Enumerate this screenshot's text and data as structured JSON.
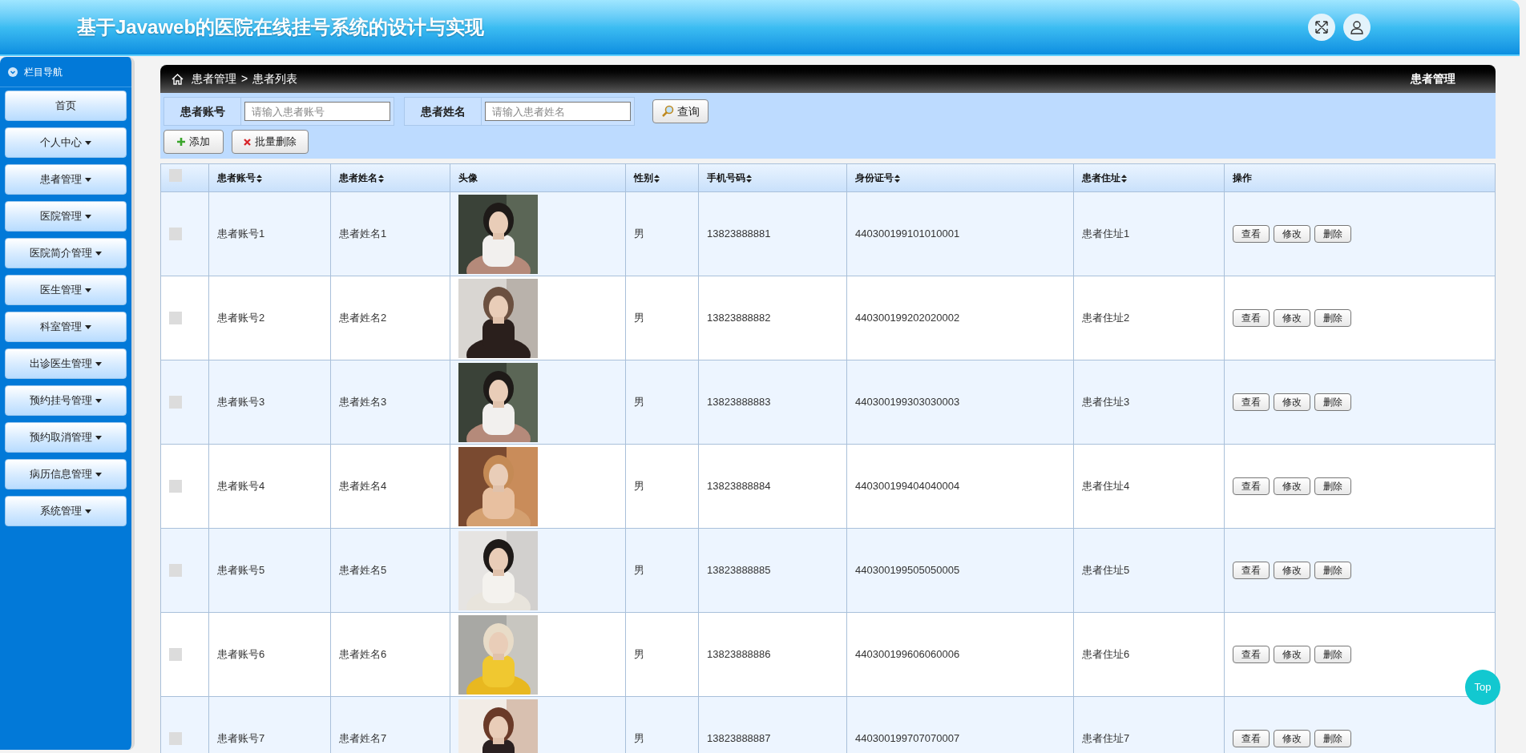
{
  "header": {
    "title": "基于Javaweb的医院在线挂号系统的设计与实现"
  },
  "sidebar": {
    "title": "栏目导航",
    "items": [
      {
        "label": "首页",
        "dropdown": false
      },
      {
        "label": "个人中心",
        "dropdown": true
      },
      {
        "label": "患者管理",
        "dropdown": true
      },
      {
        "label": "医院管理",
        "dropdown": true
      },
      {
        "label": "医院简介管理",
        "dropdown": true
      },
      {
        "label": "医生管理",
        "dropdown": true
      },
      {
        "label": "科室管理",
        "dropdown": true
      },
      {
        "label": "出诊医生管理",
        "dropdown": true
      },
      {
        "label": "预约挂号管理",
        "dropdown": true
      },
      {
        "label": "预约取消管理",
        "dropdown": true
      },
      {
        "label": "病历信息管理",
        "dropdown": true
      },
      {
        "label": "系统管理",
        "dropdown": true
      }
    ]
  },
  "breadcrumb": {
    "path": [
      "患者管理",
      "患者列表"
    ],
    "separator": ">",
    "section": "患者管理"
  },
  "filters": [
    {
      "label": "患者账号",
      "placeholder": "请输入患者账号"
    },
    {
      "label": "患者姓名",
      "placeholder": "请输入患者姓名"
    }
  ],
  "search_button": "查询",
  "actions": [
    {
      "label": "添加",
      "kind": "add"
    },
    {
      "label": "批量删除",
      "kind": "delete"
    }
  ],
  "table": {
    "select_all_checked": false,
    "columns": [
      {
        "label": "患者账号",
        "sortable": true
      },
      {
        "label": "患者姓名",
        "sortable": true
      },
      {
        "label": "头像",
        "sortable": false
      },
      {
        "label": "性别",
        "sortable": true
      },
      {
        "label": "手机号码",
        "sortable": true
      },
      {
        "label": "身份证号",
        "sortable": true
      },
      {
        "label": "患者住址",
        "sortable": true
      },
      {
        "label": "操作",
        "sortable": false
      }
    ],
    "rows": [
      {
        "checked": false,
        "account": "患者账号1",
        "name": "患者姓名1",
        "gender": "男",
        "phone": "13823888881",
        "id_number": "440300199101010001",
        "address": "患者住址1",
        "buttons": [
          "查看",
          "修改",
          "删除"
        ]
      },
      {
        "checked": false,
        "account": "患者账号2",
        "name": "患者姓名2",
        "gender": "男",
        "phone": "13823888882",
        "id_number": "440300199202020002",
        "address": "患者住址2",
        "buttons": [
          "查看",
          "修改",
          "删除"
        ]
      },
      {
        "checked": false,
        "account": "患者账号3",
        "name": "患者姓名3",
        "gender": "男",
        "phone": "13823888883",
        "id_number": "440300199303030003",
        "address": "患者住址3",
        "buttons": [
          "查看",
          "修改",
          "删除"
        ]
      },
      {
        "checked": false,
        "account": "患者账号4",
        "name": "患者姓名4",
        "gender": "男",
        "phone": "13823888884",
        "id_number": "440300199404040004",
        "address": "患者住址4",
        "buttons": [
          "查看",
          "修改",
          "删除"
        ]
      },
      {
        "checked": false,
        "account": "患者账号5",
        "name": "患者姓名5",
        "gender": "男",
        "phone": "13823888885",
        "id_number": "440300199505050005",
        "address": "患者住址5",
        "buttons": [
          "查看",
          "修改",
          "删除"
        ]
      },
      {
        "checked": false,
        "account": "患者账号6",
        "name": "患者姓名6",
        "gender": "男",
        "phone": "13823888886",
        "id_number": "440300199606060006",
        "address": "患者住址6",
        "buttons": [
          "查看",
          "修改",
          "删除"
        ]
      },
      {
        "checked": false,
        "account": "患者账号7",
        "name": "患者姓名7",
        "gender": "男",
        "phone": "13823888887",
        "id_number": "440300199707070007",
        "address": "患者住址7",
        "buttons": [
          "查看",
          "修改",
          "删除"
        ]
      }
    ]
  },
  "top_button": "Top"
}
